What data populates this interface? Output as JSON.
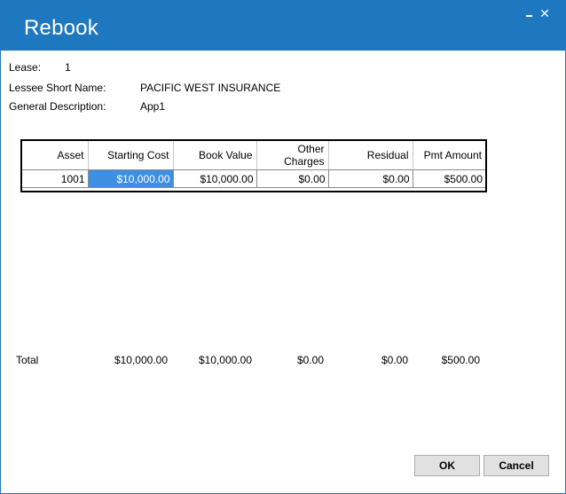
{
  "window": {
    "title": "Rebook",
    "minimize_glyph": "",
    "close_glyph": "✕"
  },
  "info": {
    "lease_label": "Lease:",
    "lease_value": "1",
    "lessee_label": "Lessee Short Name:",
    "lessee_value": "PACIFIC WEST INSURANCE",
    "description_label": "General Description:",
    "description_value": "App1"
  },
  "grid": {
    "columns": [
      "Asset",
      "Starting Cost",
      "Book Value",
      "Other Charges",
      "Residual",
      "Pmt Amount"
    ],
    "rows": [
      [
        "1001",
        "$10,000.00",
        "$10,000.00",
        "$0.00",
        "$0.00",
        "$500.00"
      ]
    ],
    "selected_cell": "Starting Cost"
  },
  "totals": {
    "label": "Total",
    "starting_cost": "$10,000.00",
    "book_value": "$10,000.00",
    "other_charges": "$0.00",
    "residual": "$0.00",
    "pmt_amount": "$500.00"
  },
  "buttons": {
    "ok": "OK",
    "cancel": "Cancel"
  },
  "colors": {
    "titlebar": "#1e78c0",
    "selection": "#3e8fe4"
  }
}
